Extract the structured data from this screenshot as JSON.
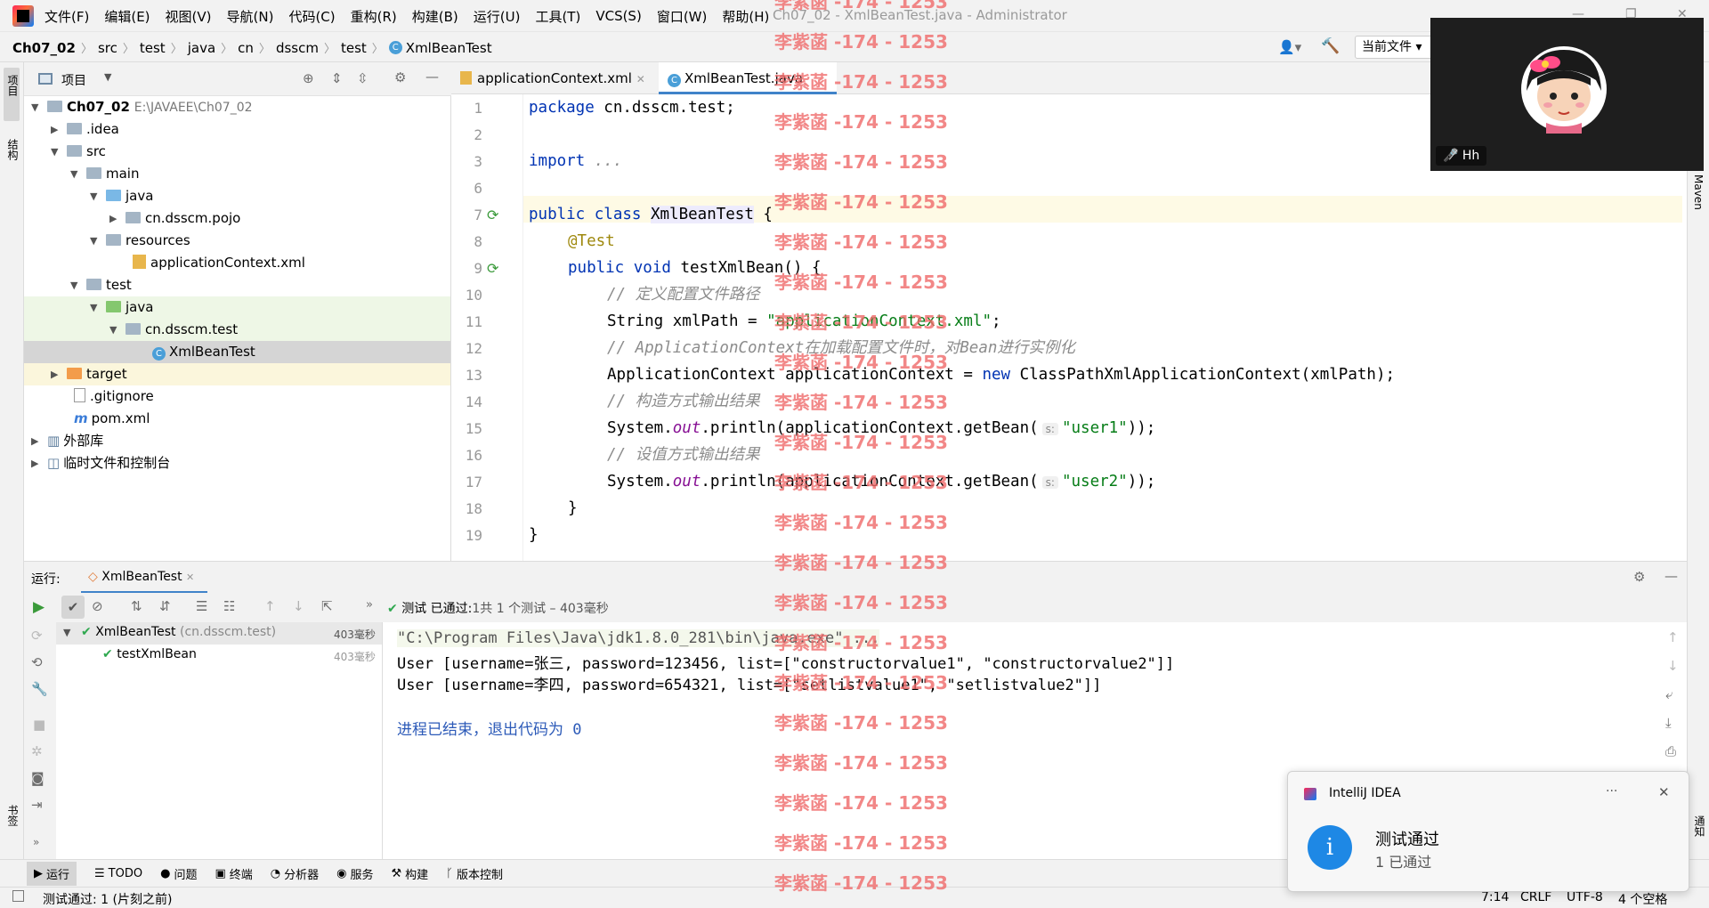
{
  "menubar": {
    "items": [
      "文件(F)",
      "编辑(E)",
      "视图(V)",
      "导航(N)",
      "代码(C)",
      "重构(R)",
      "构建(B)",
      "运行(U)",
      "工具(T)",
      "VCS(S)",
      "窗口(W)",
      "帮助(H)"
    ],
    "window_title": "Ch07_02 - XmlBeanTest.java - Administrator"
  },
  "navbar": {
    "crumbs": [
      "Ch07_02",
      "src",
      "test",
      "java",
      "cn",
      "dsscm",
      "test",
      "XmlBeanTest"
    ],
    "run_config": "当前文件"
  },
  "left_strip": {
    "project": "项目",
    "structure": "结构",
    "bookmarks": "书签"
  },
  "right_strip": {
    "maven": "Maven",
    "notifications": "通知"
  },
  "project": {
    "title": "项目",
    "tree": [
      {
        "label": "Ch07_02",
        "extra": "E:\\JAVAEE\\Ch07_02"
      },
      {
        "label": ".idea"
      },
      {
        "label": "src"
      },
      {
        "label": "main"
      },
      {
        "label": "java"
      },
      {
        "label": "cn.dsscm.pojo"
      },
      {
        "label": "resources"
      },
      {
        "label": "applicationContext.xml"
      },
      {
        "label": "test"
      },
      {
        "label": "java"
      },
      {
        "label": "cn.dsscm.test"
      },
      {
        "label": "XmlBeanTest"
      },
      {
        "label": "target"
      },
      {
        "label": ".gitignore"
      },
      {
        "label": "pom.xml"
      },
      {
        "label": "外部库"
      },
      {
        "label": "临时文件和控制台"
      }
    ]
  },
  "editor": {
    "tabs": [
      "applicationContext.xml",
      "XmlBeanTest.java"
    ],
    "line_numbers": [
      "1",
      "2",
      "3",
      "6",
      "7",
      "8",
      "9",
      "10",
      "11",
      "12",
      "13",
      "14",
      "15",
      "16",
      "17",
      "18",
      "19"
    ],
    "code": {
      "l1_kw": "package",
      "l1_rest": " cn.dsscm.test;",
      "l3_kw": "import",
      "l3_rest": " ...",
      "l7_kw": "public class",
      "l7_cls": "XmlBeanTest",
      "l7_rest": " {",
      "l8_ann": "@Test",
      "l9_kw": "public void",
      "l9_rest": " testXmlBean() {",
      "l10_cm": "// 定义配置文件路径",
      "l11_a": "String xmlPath = ",
      "l11_str": "\"applicationContext.xml\"",
      "l11_b": ";",
      "l12_cm": "// ApplicationContext在加载配置文件时，对Bean进行实例化",
      "l13_a": "ApplicationContext applicationContext = ",
      "l13_kw": "new",
      "l13_b": " ClassPathXmlApplicationContext(xmlPath);",
      "l14_cm": "// 构造方式输出结果",
      "l15_a": "System.",
      "l15_fld": "out",
      "l15_b": ".println(applicationContext.getBean(",
      "l15_hint": "s:",
      "l15_str": "\"user1\"",
      "l15_c": "));",
      "l16_cm": "// 设值方式输出结果",
      "l17_a": "System.",
      "l17_fld": "out",
      "l17_b": ".println(applicationContext.getBean(",
      "l17_hint": "s:",
      "l17_str": "\"user2\"",
      "l17_c": "));",
      "l18": "}",
      "l19": "}"
    }
  },
  "run": {
    "label": "运行:",
    "tab": "XmlBeanTest",
    "status_prefix": "测试",
    "status_passed": "已通过:",
    "status_count": "1共 1 个测试 – 403毫秒",
    "tree": [
      {
        "name": "XmlBeanTest",
        "pkg": "(cn.dsscm.test)",
        "time": "403毫秒"
      },
      {
        "name": "testXmlBean",
        "time": "403毫秒"
      }
    ],
    "console": [
      "\"C:\\Program Files\\Java\\jdk1.8.0_281\\bin\\java.exe\" ...",
      "User [username=张三, password=123456, list=[\"constructorvalue1\", \"constructorvalue2\"]]",
      "User [username=李四, password=654321, list=[\"setlistvalue1\", \"setlistvalue2\"]]",
      "进程已结束，退出代码为 0"
    ]
  },
  "bottom_tabs": [
    "运行",
    "TODO",
    "问题",
    "终端",
    "分析器",
    "服务",
    "构建",
    "版本控制"
  ],
  "statusbar": {
    "message": "测试通过: 1 (片刻之前)",
    "position": "7:14",
    "line_sep": "CRLF",
    "encoding": "UTF-8",
    "indent": "4 个空格"
  },
  "video": {
    "name": "Hh"
  },
  "notification": {
    "app": "IntelliJ IDEA",
    "title": "测试通过",
    "body": "1 已通过",
    "more": "···",
    "close": "✕"
  },
  "watermark": {
    "text": "李紫菡 -174 - 1253"
  },
  "colors": {
    "keyword": "#0033b3",
    "string": "#067d17",
    "comment": "#8c8c8c",
    "pass": "#2fa84f",
    "accent": "#1e88e5",
    "watermark": "#f06a6a"
  }
}
